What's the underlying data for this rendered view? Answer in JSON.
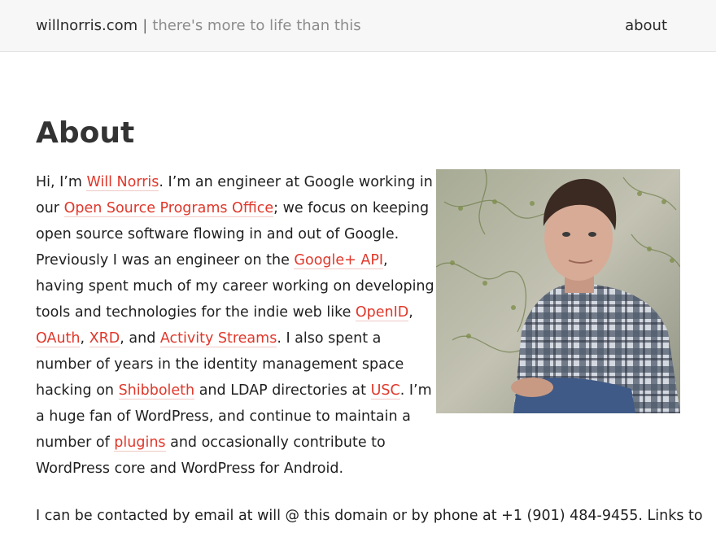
{
  "header": {
    "site_name": "willnorris.com",
    "separator": "|",
    "tagline": "there's more to life than this",
    "nav_about": "about"
  },
  "page": {
    "title": "About",
    "photo_alt": "Will Norris portrait"
  },
  "intro": {
    "t1": "Hi, I’m ",
    "l1": "Will Norris",
    "t2": ". I’m an engineer at Google working in our ",
    "l2": "Open Source Programs Office",
    "t3": "; we focus on keeping open source software flowing in and out of Google. Previously I was an engineer on the ",
    "l3": "Google+ API",
    "t4": ", having spent much of my career working on developing tools and technologies for the indie web like ",
    "l4": "OpenID",
    "t5": ", ",
    "l5": "OAuth",
    "t6": ", ",
    "l6": "XRD",
    "t7": ", and ",
    "l7": "Activity Streams",
    "t8": ". I also spent a number of years in the identity management space hacking on ",
    "l8": "Shibboleth",
    "t9": " and LDAP directories at ",
    "l9": "USC",
    "t10": ". I’m a huge fan of WordPress, and continue to maintain a number of ",
    "l10": "plugins",
    "t11": " and occasionally contribute to WordPress core and WordPress for Android."
  },
  "contact": {
    "text": "I can be contacted by email at will @ this domain or by phone at +1 (901) 484-9455. Links to"
  }
}
